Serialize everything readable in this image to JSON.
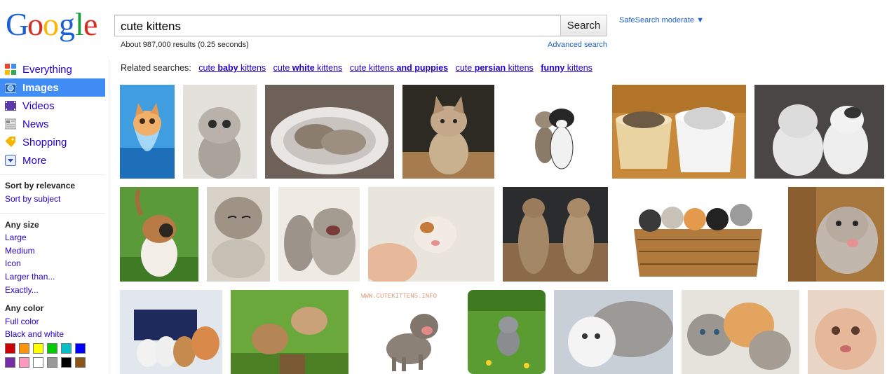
{
  "logo": {
    "text": "Google"
  },
  "search": {
    "query": "cute kittens",
    "button_label": "Search"
  },
  "safesearch": {
    "label": "SafeSearch moderate ▼"
  },
  "stats": {
    "text": "About 987,000 results (0.25 seconds)",
    "advanced_label": "Advanced search"
  },
  "nav": {
    "items": [
      {
        "label": "Everything",
        "icon": "everything-icon"
      },
      {
        "label": "Images",
        "icon": "camera-icon",
        "active": true
      },
      {
        "label": "Videos",
        "icon": "film-icon"
      },
      {
        "label": "News",
        "icon": "newspaper-icon"
      },
      {
        "label": "Shopping",
        "icon": "tag-icon"
      },
      {
        "label": "More",
        "icon": "chevron-down-icon"
      }
    ]
  },
  "tools": {
    "sort_heading": "Sort by relevance",
    "sort_subject": "Sort by subject",
    "size_heading": "Any size",
    "size_options": [
      "Large",
      "Medium",
      "Icon",
      "Larger than...",
      "Exactly..."
    ],
    "color_heading": "Any color",
    "color_options": [
      "Full color",
      "Black and white"
    ],
    "swatches": [
      "#cc0000",
      "#fb940b",
      "#ffff00",
      "#00cc00",
      "#03c0c6",
      "#0000ff",
      "#762ca7",
      "#ff98bf",
      "#ffffff",
      "#999999",
      "#000000",
      "#885418"
    ]
  },
  "related": {
    "label": "Related searches:",
    "links": [
      {
        "plain": "cute ",
        "bold": "baby",
        "rest": " kittens"
      },
      {
        "plain": "cute ",
        "bold": "white",
        "rest": " kittens"
      },
      {
        "plain": "cute kittens ",
        "bold": "and puppies",
        "rest": ""
      },
      {
        "plain": "cute ",
        "bold": "persian",
        "rest": " kittens"
      },
      {
        "plain": "",
        "bold": "funny",
        "rest": " kittens"
      }
    ]
  },
  "watermarks": {
    "cutekittens": "WWW.CUTEKITTENS.INFO"
  }
}
